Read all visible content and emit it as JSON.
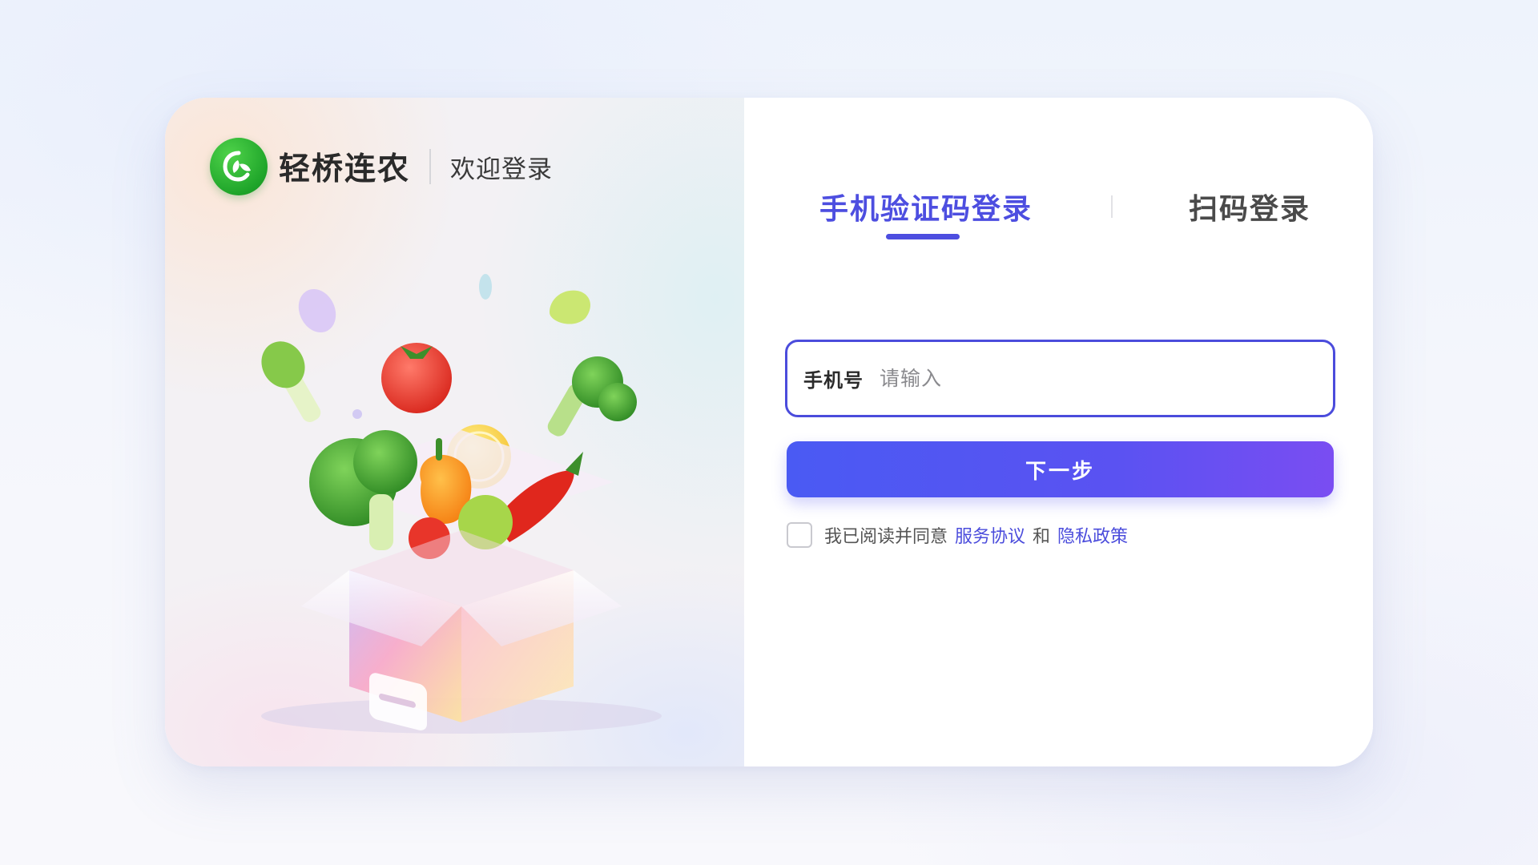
{
  "brand": {
    "name": "轻桥连农",
    "welcome": "欢迎登录",
    "logo_color": "#22a52c"
  },
  "tabs": [
    {
      "label": "手机验证码登录",
      "active": true
    },
    {
      "label": "扫码登录",
      "active": false
    }
  ],
  "form": {
    "phone_label": "手机号",
    "phone_placeholder": "请输入",
    "phone_value": "",
    "submit_label": "下一步"
  },
  "agreement": {
    "prefix": "我已阅读并同意",
    "service_link": "服务协议",
    "connector": "和",
    "privacy_link": "隐私政策",
    "checked": false
  },
  "colors": {
    "accent": "#4d4ee0",
    "button_gradient_start": "#4a5af3",
    "button_gradient_end": "#7a4df2"
  }
}
